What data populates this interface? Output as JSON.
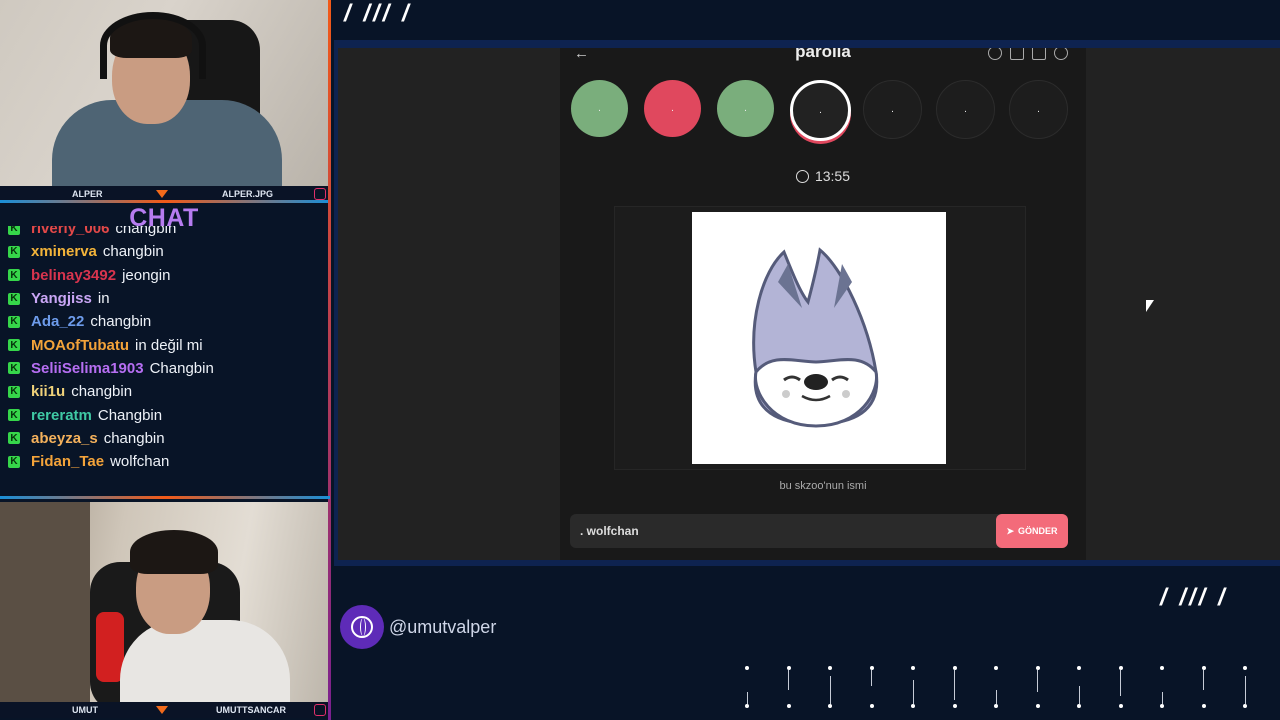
{
  "streamers": {
    "top": {
      "name_left": "ALPER",
      "name_right": "ALPER.JPG"
    },
    "bottom": {
      "name_left": "UMUT",
      "name_right": "UMUTTSANCAR"
    }
  },
  "chat": {
    "title": "CHAT",
    "messages": [
      {
        "user": "riverly_006",
        "text": "changbin",
        "color": "#e24848"
      },
      {
        "user": "xminerva",
        "text": "changbin",
        "color": "#f3b43a"
      },
      {
        "user": "belinay3492",
        "text": "jeongin",
        "color": "#d8344e"
      },
      {
        "user": "Yangjiss",
        "text": "in",
        "color": "#c9a6f5"
      },
      {
        "user": "Ada_22",
        "text": "changbin",
        "color": "#6d9bea"
      },
      {
        "user": "MOAofTubatu",
        "text": "in değil mi",
        "color": "#f3a33a"
      },
      {
        "user": "SeliiSelima1903",
        "text": "Changbin",
        "color": "#b66ef2"
      },
      {
        "user": "kii1u",
        "text": "changbin",
        "color": "#f0d27a"
      },
      {
        "user": "rereratm",
        "text": "Changbin",
        "color": "#3fc9a4"
      },
      {
        "user": "abeyza_s",
        "text": "changbin",
        "color": "#f4b15c"
      },
      {
        "user": "Fidan_Tae",
        "text": "wolfchan",
        "color": "#f3a33a"
      }
    ]
  },
  "game": {
    "title": "parolla",
    "timer": "13:55",
    "hint": "bu skzoo'nun ismi",
    "input_value": ". wolfchan",
    "send_label": "GÖNDER",
    "progress": [
      {
        "state": "correct",
        "color": "#7aae7c"
      },
      {
        "state": "wrong",
        "color": "#e0485e"
      },
      {
        "state": "correct",
        "color": "#7aae7c"
      },
      {
        "state": "current",
        "color": "#222222"
      },
      {
        "state": "pending",
        "color": "#1d1d1d"
      },
      {
        "state": "pending",
        "color": "#1d1d1d"
      },
      {
        "state": "pending",
        "color": "#1d1d1d"
      }
    ]
  },
  "footer": {
    "handle": "@umutvalper"
  },
  "decor": {
    "slashes": "/ /// /"
  }
}
